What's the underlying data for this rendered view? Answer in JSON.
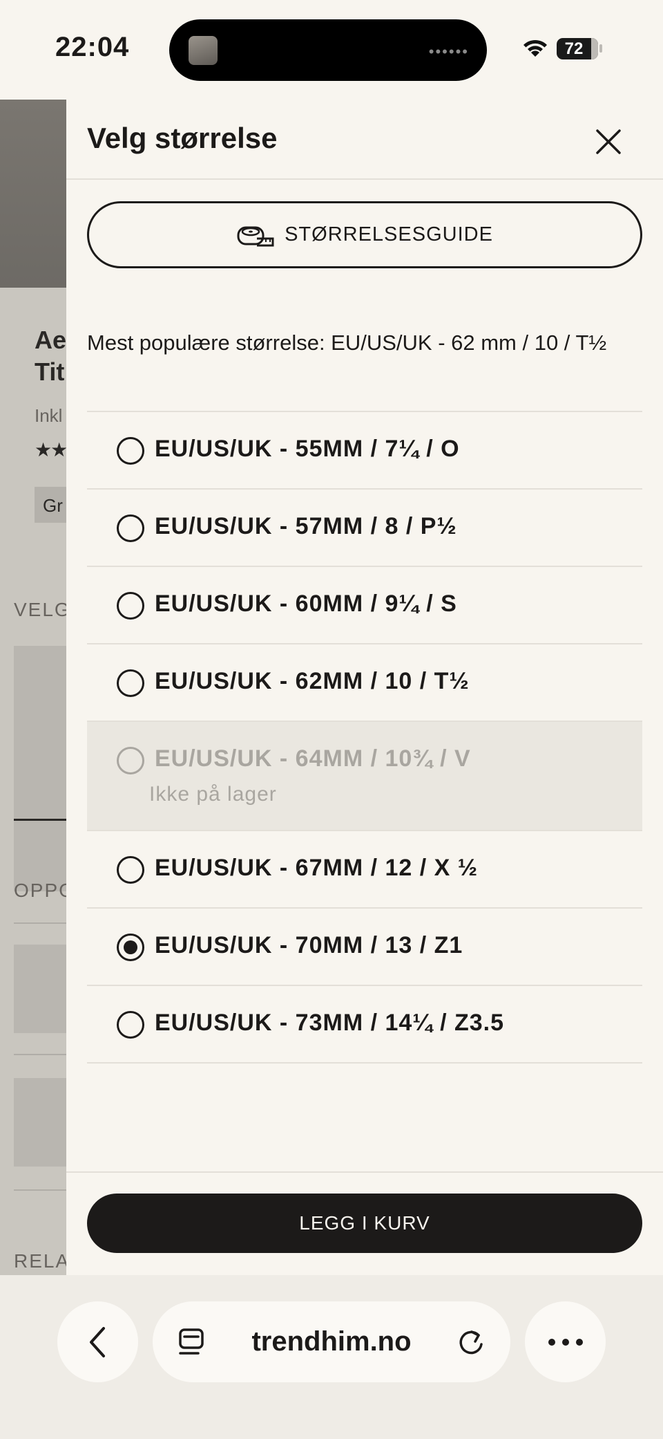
{
  "status_bar": {
    "time": "22:04",
    "battery": "72"
  },
  "background_page": {
    "title_line1": "Ae",
    "title_line2": "Tit",
    "incl_text": "Inkl",
    "stars": "★★",
    "chip_text": "Gr",
    "section_1": "VELG",
    "section_2": "OPPG",
    "section_3": "RELA"
  },
  "sheet": {
    "title": "Velg størrelse",
    "guide_button_label": "STØRRELSESGUIDE",
    "popular_text": "Mest populære størrelse: EU/US/UK - 62 mm / 10 / T½",
    "sizes": [
      {
        "label": "EU/US/UK - 55MM / 7¼ / O",
        "selected": false,
        "available": true,
        "note": ""
      },
      {
        "label": "EU/US/UK - 57MM / 8 / P½",
        "selected": false,
        "available": true,
        "note": ""
      },
      {
        "label": "EU/US/UK - 60MM / 9¼ / S",
        "selected": false,
        "available": true,
        "note": ""
      },
      {
        "label": "EU/US/UK - 62MM / 10 / T½",
        "selected": false,
        "available": true,
        "note": ""
      },
      {
        "label": "EU/US/UK - 64MM / 10¾ / V",
        "selected": false,
        "available": false,
        "note": "Ikke på lager"
      },
      {
        "label": "EU/US/UK - 67MM / 12 / X ½",
        "selected": false,
        "available": true,
        "note": ""
      },
      {
        "label": "EU/US/UK - 70MM / 13 / Z1",
        "selected": true,
        "available": true,
        "note": ""
      },
      {
        "label": "EU/US/UK - 73MM / 14¼ / Z3.5",
        "selected": false,
        "available": true,
        "note": ""
      }
    ],
    "add_to_cart_label": "LEGG I KURV"
  },
  "browser": {
    "url": "trendhim.no"
  },
  "colors": {
    "primary": "#1c1a19",
    "background": "#f8f5ef",
    "disabled_row": "#eae7e0",
    "disabled_text": "#a9a6a0"
  }
}
